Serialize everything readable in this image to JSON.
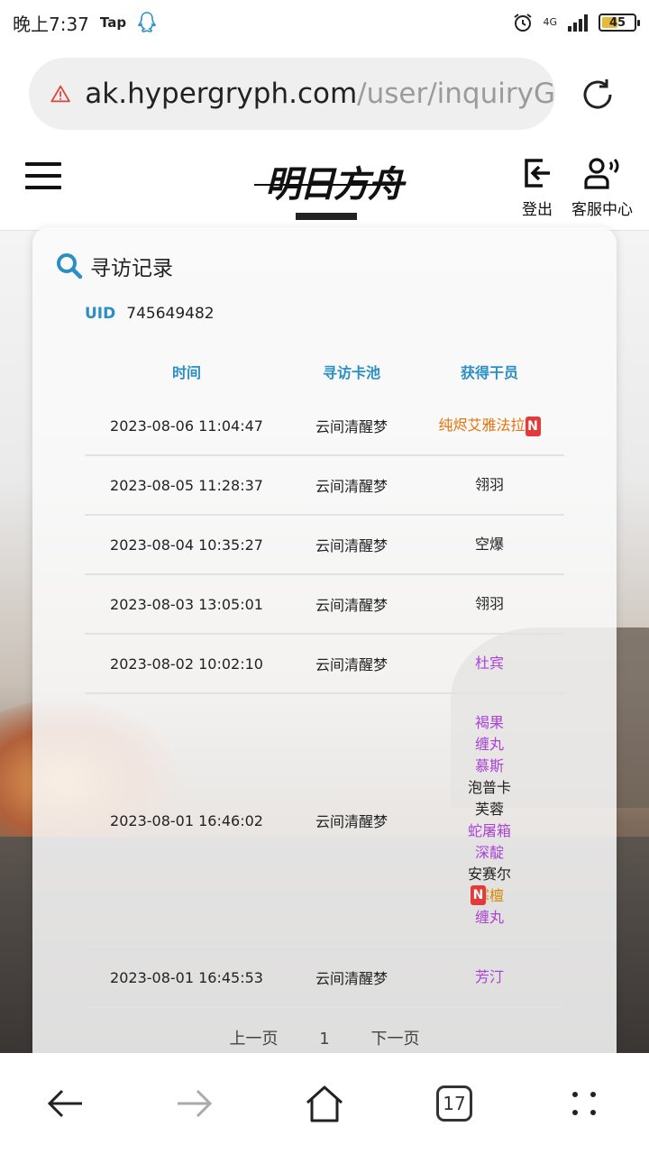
{
  "status_bar": {
    "time": "晚上7:37",
    "app_label": "Tap",
    "network": "4G",
    "battery": "45",
    "battery_level": 0.45
  },
  "browser": {
    "url_host": "ak.hypergryph.com",
    "url_path": "/user/inquiryG",
    "tab_count": "17"
  },
  "header": {
    "logo_text": "明日方舟",
    "logout_label": "登出",
    "service_label": "客服中心"
  },
  "card": {
    "title": "寻访记录",
    "uid_label": "UID",
    "uid_value": "745649482",
    "columns": {
      "time": "时间",
      "pool": "寻访卡池",
      "operator": "获得干员"
    },
    "rows": [
      {
        "time": "2023-08-06 11:04:47",
        "pool": "云间清醒梦",
        "operators": [
          {
            "name": "纯烬艾雅法拉",
            "rarity": 6,
            "new": true
          }
        ]
      },
      {
        "time": "2023-08-05 11:28:37",
        "pool": "云间清醒梦",
        "operators": [
          {
            "name": "翎羽",
            "rarity": 3,
            "new": false
          }
        ]
      },
      {
        "time": "2023-08-04 10:35:27",
        "pool": "云间清醒梦",
        "operators": [
          {
            "name": "空爆",
            "rarity": 3,
            "new": false
          }
        ]
      },
      {
        "time": "2023-08-03 13:05:01",
        "pool": "云间清醒梦",
        "operators": [
          {
            "name": "翎羽",
            "rarity": 3,
            "new": false
          }
        ]
      },
      {
        "time": "2023-08-02 10:02:10",
        "pool": "云间清醒梦",
        "operators": [
          {
            "name": "杜宾",
            "rarity": 4,
            "new": false
          }
        ]
      },
      {
        "time": "2023-08-01 16:46:02",
        "pool": "云间清醒梦",
        "operators": [
          {
            "name": "褐果",
            "rarity": 4,
            "new": false
          },
          {
            "name": "缠丸",
            "rarity": 4,
            "new": false
          },
          {
            "name": "慕斯",
            "rarity": 4,
            "new": false
          },
          {
            "name": "泡普卡",
            "rarity": 3,
            "new": false
          },
          {
            "name": "芙蓉",
            "rarity": 3,
            "new": false
          },
          {
            "name": "蛇屠箱",
            "rarity": 4,
            "new": false
          },
          {
            "name": "深靛",
            "rarity": 4,
            "new": false
          },
          {
            "name": "安赛尔",
            "rarity": 3,
            "new": false
          },
          {
            "name": "寒檀",
            "rarity": 5,
            "new": true
          },
          {
            "name": "缠丸",
            "rarity": 4,
            "new": false
          }
        ]
      },
      {
        "time": "2023-08-01 16:45:53",
        "pool": "云间清醒梦",
        "operators": [
          {
            "name": "芳汀",
            "rarity": 4,
            "new": false
          }
        ]
      }
    ],
    "new_badge": "N",
    "pager": {
      "prev": "上一页",
      "page": "1",
      "next": "下一页"
    }
  },
  "colors": {
    "accent": "#2a8fc4",
    "six_star": "#e8730d",
    "five_star": "#d58c0a",
    "four_star": "#a843d6",
    "new_badge": "#e33a3a"
  },
  "icons": [
    "warning-icon",
    "reload-icon",
    "menu-icon",
    "logout-icon",
    "service-icon",
    "search-icon",
    "back-icon",
    "forward-icon",
    "home-icon",
    "tabs-icon",
    "more-icon",
    "qq-icon",
    "alarm-icon",
    "signal-icon"
  ]
}
